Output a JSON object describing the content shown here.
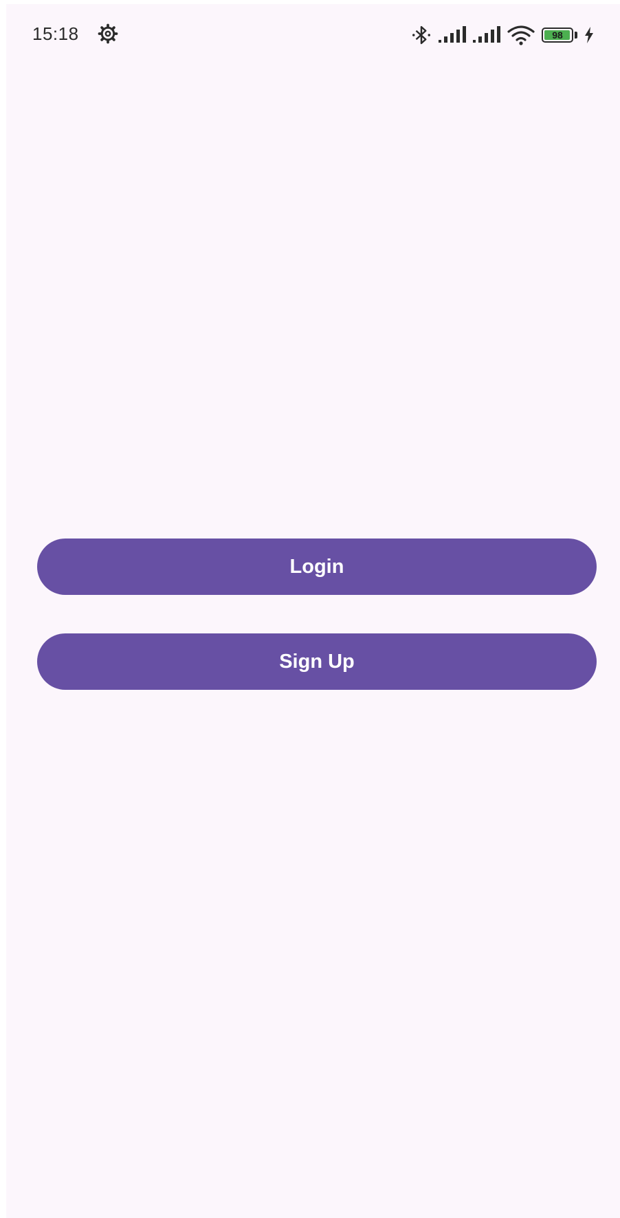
{
  "status_bar": {
    "time": "15:18",
    "battery_level": "98",
    "icons": [
      "settings-gear-icon",
      "bluetooth-icon",
      "signal-icon",
      "signal-icon",
      "wifi-icon",
      "battery-icon",
      "charging-bolt-icon"
    ]
  },
  "actions": {
    "login_label": "Login",
    "signup_label": "Sign Up"
  },
  "colors": {
    "background": "#fcf6fc",
    "primary": "#6750a4",
    "on_primary": "#ffffff",
    "status_text": "#2b2b2b",
    "battery_fill": "#4caf50"
  }
}
